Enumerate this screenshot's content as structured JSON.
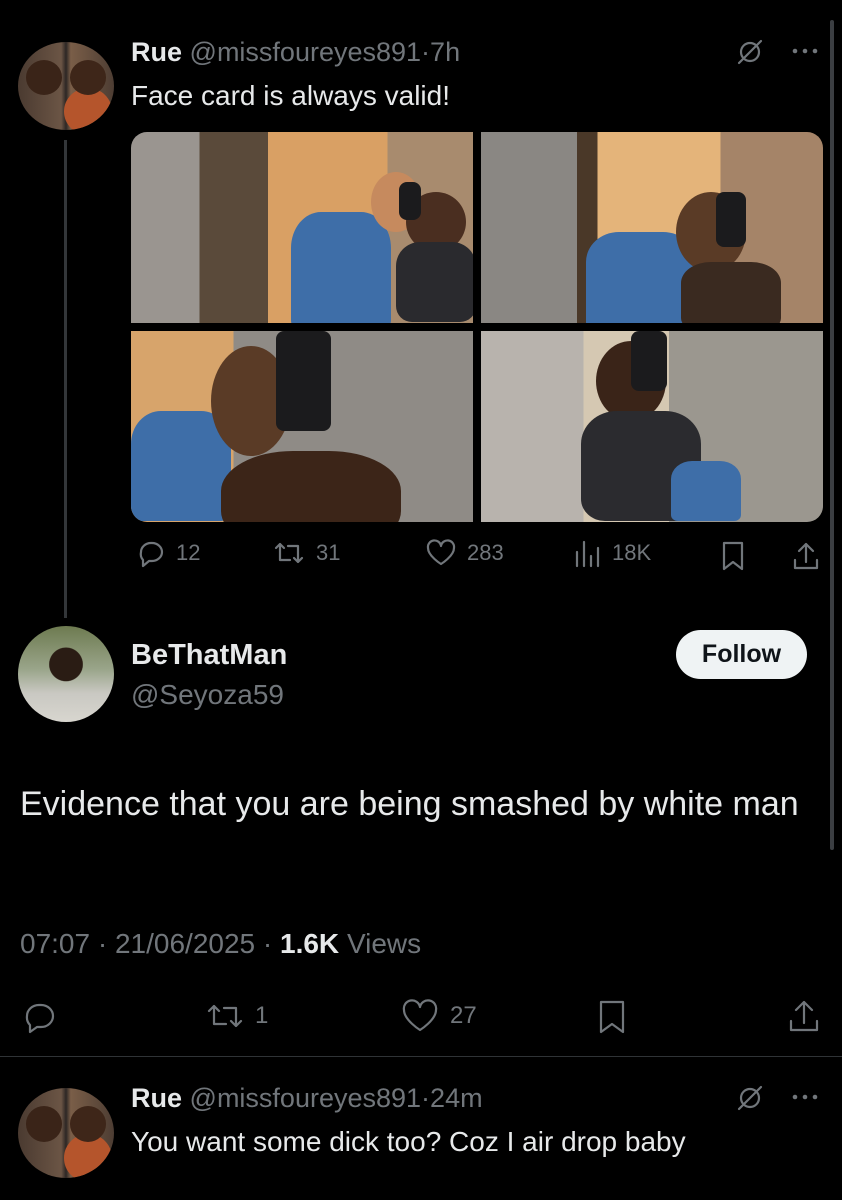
{
  "tweet1": {
    "name": "Rue",
    "handle": "@missfoureyes891",
    "sep": "·",
    "time": "7h",
    "text": "Face card is always valid!",
    "actions": {
      "replies": "12",
      "reposts": "31",
      "likes": "283",
      "views": "18K"
    }
  },
  "tweet2": {
    "name": "BeThatMan",
    "handle": "@Seyoza59",
    "follow_label": "Follow",
    "text": "Evidence that you are being smashed by white man",
    "time": "07:07",
    "date": "21/06/2025",
    "views_count": "1.6K",
    "views_label": "Views",
    "actions": {
      "reposts": "1",
      "likes": "27"
    }
  },
  "tweet3": {
    "name": "Rue",
    "handle": "@missfoureyes891",
    "sep": "·",
    "time": "24m",
    "text": "You want some dick too? Coz I air drop baby"
  },
  "icons": [
    "grok-icon",
    "more-icon",
    "reply-icon",
    "repost-icon",
    "like-icon",
    "views-icon",
    "bookmark-icon",
    "share-icon"
  ],
  "colors": {
    "background": "#000000",
    "text": "#e7e9ea",
    "muted": "#71767b",
    "button_bg": "#eff3f4"
  }
}
